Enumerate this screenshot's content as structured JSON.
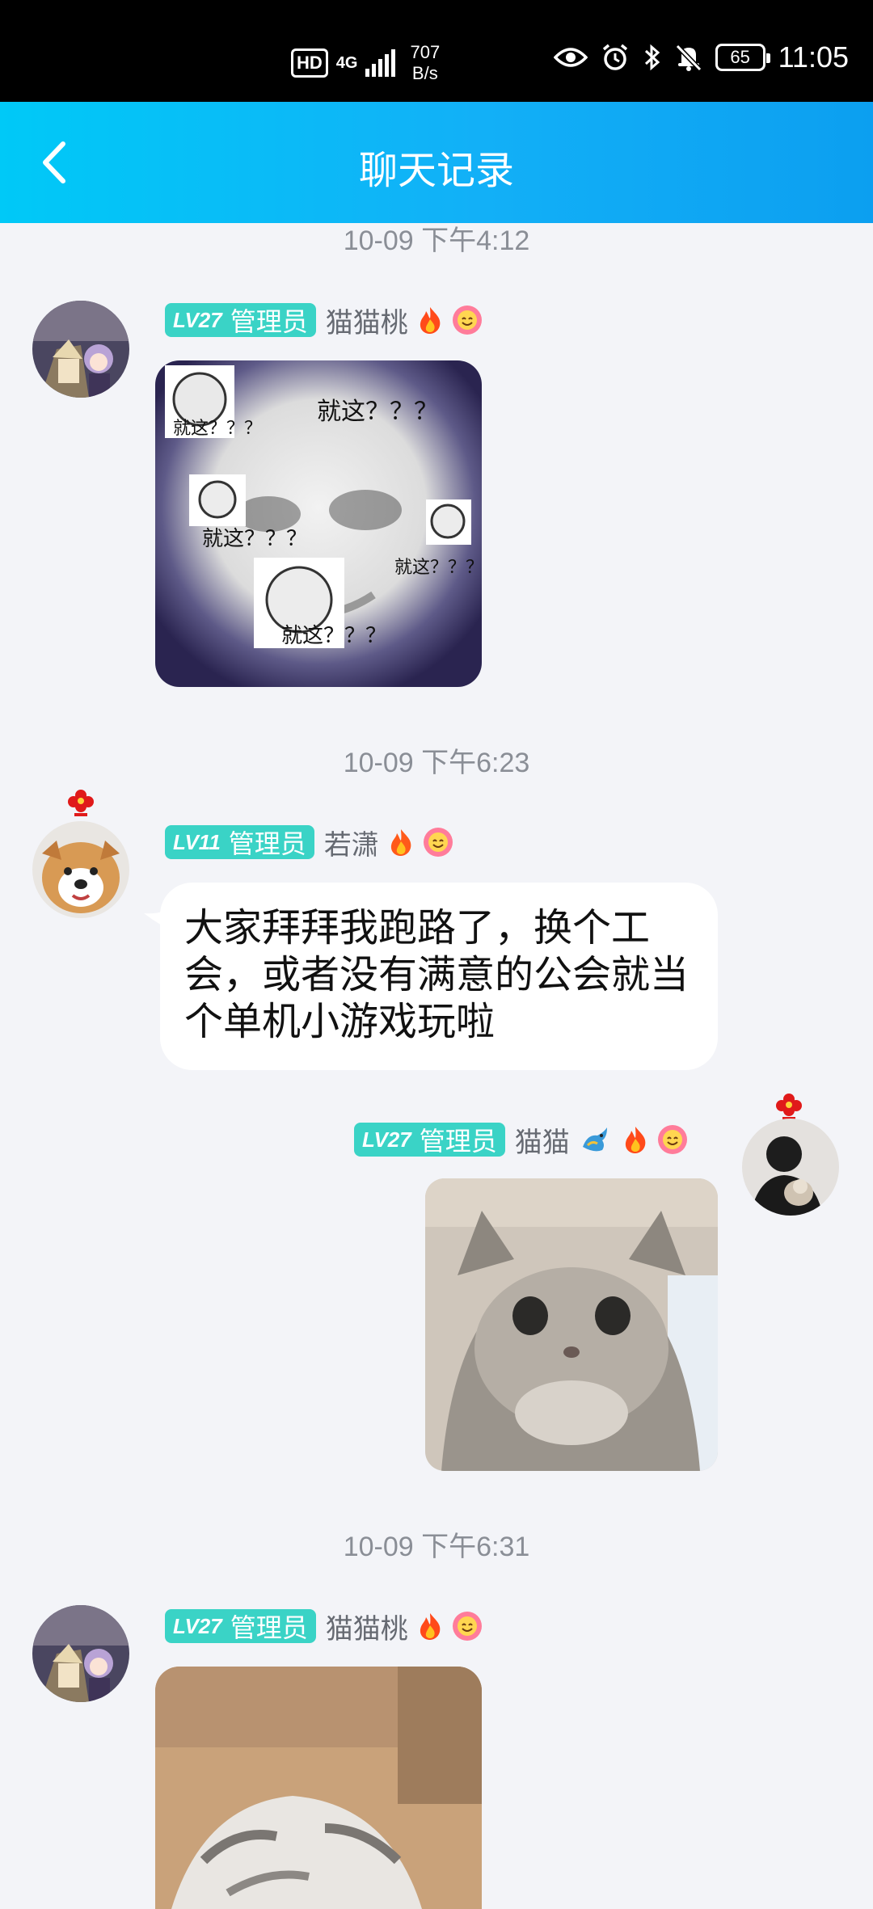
{
  "status_bar": {
    "hd": "HD",
    "network": "4G",
    "speed_value": "707",
    "speed_unit": "B/s",
    "battery": "65",
    "time": "11:05"
  },
  "header": {
    "title": "聊天记录"
  },
  "timestamps": [
    "10-09 下午4:12",
    "10-09 下午6:23",
    "10-09 下午6:31"
  ],
  "messages": [
    {
      "tag_level": "LV27",
      "tag_role": "管理员",
      "nickname": "猫猫桃",
      "meme_texts": [
        "就这？？？",
        "就这？？？",
        "就这？？？",
        "就这？？？",
        "就这？？？"
      ]
    },
    {
      "tag_level": "LV11",
      "tag_role": "管理员",
      "nickname": "若潇",
      "text": "大家拜拜我跑路了，换个工会，或者没有满意的公会就当个单机小游戏玩啦"
    },
    {
      "tag_level": "LV27",
      "tag_role": "管理员",
      "nickname": "猫猫"
    },
    {
      "tag_level": "LV27",
      "tag_role": "管理员",
      "nickname": "猫猫桃"
    }
  ],
  "colors": {
    "header_start": "#00c9f7",
    "header_end": "#0c9ff0",
    "tag": "#3ad3c6",
    "background": "#f3f4f8"
  },
  "icons": [
    "back-arrow-icon",
    "eye-icon",
    "alarm-icon",
    "bluetooth-icon",
    "mute-bell-icon",
    "fire-icon",
    "smile-flower-icon",
    "dragon-icon",
    "flower-accessory-icon"
  ]
}
